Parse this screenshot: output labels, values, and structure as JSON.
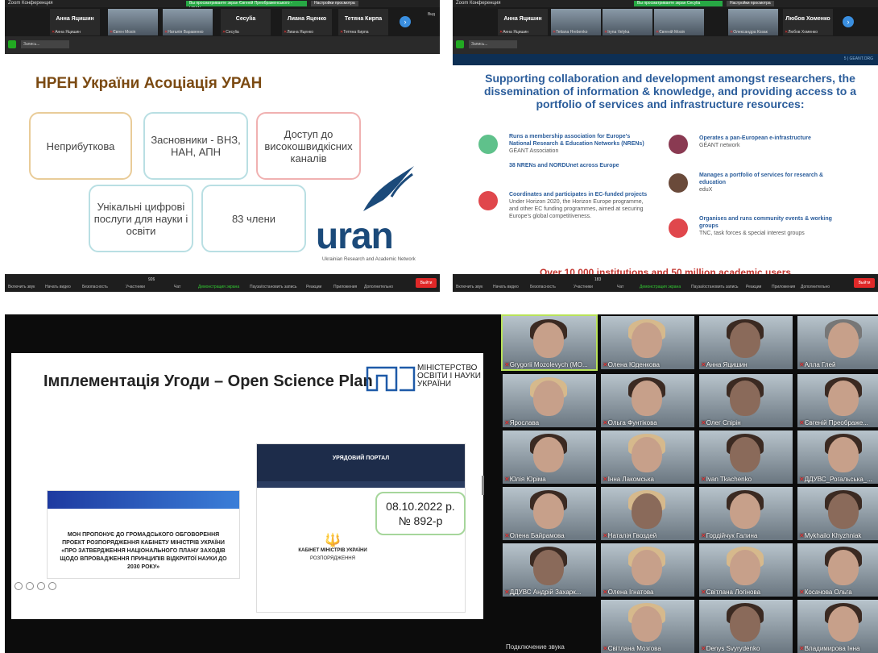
{
  "window_title": "Zoom Конференция",
  "panel1": {
    "title": "Zoom Конференция",
    "sharing_notice": "Вы просматриваете экран Євгеній Преображенського - URAN",
    "view_options": "Настройки просмотра",
    "view_label": "Вид",
    "participants": [
      {
        "name": "Анна Яцишин",
        "sub": "Анна Яцишин"
      },
      {
        "name": "",
        "sub": "Євген Mosin"
      },
      {
        "name": "",
        "sub": "Наталія Варавенко"
      },
      {
        "name": "Сесуlia",
        "sub": "Сесуlia"
      },
      {
        "name": "Лиана Яценко",
        "sub": "Лиана Яценко"
      },
      {
        "name": "Тетяна Кирпа",
        "sub": "Тетяна Кирпа"
      }
    ],
    "search_label": "Запись...",
    "slide": {
      "title": "НРЕН України Асоціація УРАН",
      "boxes": [
        "Неприбуткова",
        "Засновники - ВНЗ, НАН, АПН",
        "Доступ до високошвидкісних каналів",
        "Унікальні цифрові послуги для науки і освіти",
        "83 члени"
      ],
      "logo": "uran",
      "logo_sub": "Ukrainian Research and Academic Network"
    },
    "toolbar": [
      "Включить звук",
      "Начать видео",
      "Безопасность",
      "Участники",
      "Чат",
      "Демонстрация экрана",
      "Пауза/остановить запись",
      "Реакции",
      "Приложения",
      "Дополнительно"
    ],
    "participants_count": "926",
    "exit": "Выйти"
  },
  "panel2": {
    "title": "Zoom Конференция",
    "sharing_notice": "Вы просматриваете экран Сесуlia",
    "view_options": "Настройки просмотра",
    "participants": [
      {
        "name": "Анна Яцишин",
        "sub": "Анна Яцишин"
      },
      {
        "name": "",
        "sub": "Tetiana Hrebenko"
      },
      {
        "name": "",
        "sub": "Iryna Velyka"
      },
      {
        "name": "",
        "sub": "Євгеній Mosin"
      },
      {
        "name": "",
        "sub": "Олександра Козак"
      },
      {
        "name": "Любов Хоменко",
        "sub": "Любов Хоменко"
      }
    ],
    "search_label": "Запись...",
    "slide_number": "5 | GEANT.ORG",
    "slide": {
      "heading": "Supporting collaboration and development amongst researchers, the dissemination of information & knowledge, and providing access to a portfolio of services and infrastructure resources:",
      "items": [
        {
          "bold": "Runs a membership association for Europe's National Research & Education Networks (NRENs)",
          "text": "GÉANT Association",
          "bold2": "38 NRENs and NORDUnet across Europe"
        },
        {
          "bold": "Coordinates and participates in EC-funded projects",
          "text": "Under Horizon 2020, the Horizon Europe programme, and other EC funding programmes, aimed at securing Europe's global competitiveness."
        },
        {
          "bold": "Operates a pan-European e-infrastructure",
          "text": "GÉANT network"
        },
        {
          "bold": "Manages a portfolio of services for research & education",
          "text": "eduX"
        },
        {
          "bold": "Organises and runs community events & working groups",
          "text": "TNC, task forces & special interest groups"
        }
      ],
      "bottom": "Over 10,000 institutions and 50 million academic users"
    },
    "toolbar": [
      "Включить звук",
      "Начать видео",
      "Безопасность",
      "Участники",
      "Чат",
      "Демонстрация экрана",
      "Пауза/остановить запись",
      "Реакции",
      "Приложения",
      "Дополнительно"
    ],
    "participants_count": "183",
    "exit": "Выйти"
  },
  "panel3": {
    "slide": {
      "title": "Імплементація Угоди – Open Science Plan",
      "ministry": "МІНІСТЕРСТВО ОСВІТИ І НАУКИ УКРАЇНИ",
      "ministry_logo": "МОН",
      "doc_title": "МОН ПРОПОНУЄ ДО ГРОМАДСЬКОГО ОБГОВОРЕННЯ ПРОЕКТ РОЗПОРЯДЖЕННЯ КАБІНЕТУ МІНІСТРІВ УКРАЇНИ «ПРО ЗАТВЕРДЖЕННЯ НАЦІОНАЛЬНОГО ПЛАНУ ЗАХОДІВ ЩОДО ВПРОВАДЖЕННЯ ПРИНЦИПІВ ВІДКРИТОЇ НАУКИ ДО 2030 РОКУ»",
      "gov_portal": "УРЯДОВИЙ ПОРТАЛ",
      "date": "08.10.2022 р.",
      "number": "№ 892-р",
      "cabinet": "КАБІНЕТ МІНІСТРІВ УКРАЇНИ",
      "order": "РОЗПОРЯДЖЕННЯ"
    },
    "audio_notice": "Подключение звука",
    "gallery": [
      "Grygorii Mozolevych (MO...",
      "Олена Юденкова",
      "Анна Яцишин",
      "Алла Глей",
      "Ярослава",
      "Ольга Фунтікова",
      "Олег Спірін",
      "Євгеній Преображе...",
      "Юлія Юрімa",
      "Інна Лакомська",
      "Ivan Tkachenko",
      "ДДУВС_Рогальська_...",
      "Олена Байрамова",
      "Наталія Гвоздей",
      "Гордійчук Галина",
      "Mykhailo Khyzhniak",
      "ДДУВС Андрій Захарк...",
      "Олена Ігнатова",
      "Світлана Логінова",
      "Косачова Ольга",
      "",
      "Світлана Мозгова",
      "Denys Svyrydenko",
      "Владимирова Інна"
    ]
  }
}
